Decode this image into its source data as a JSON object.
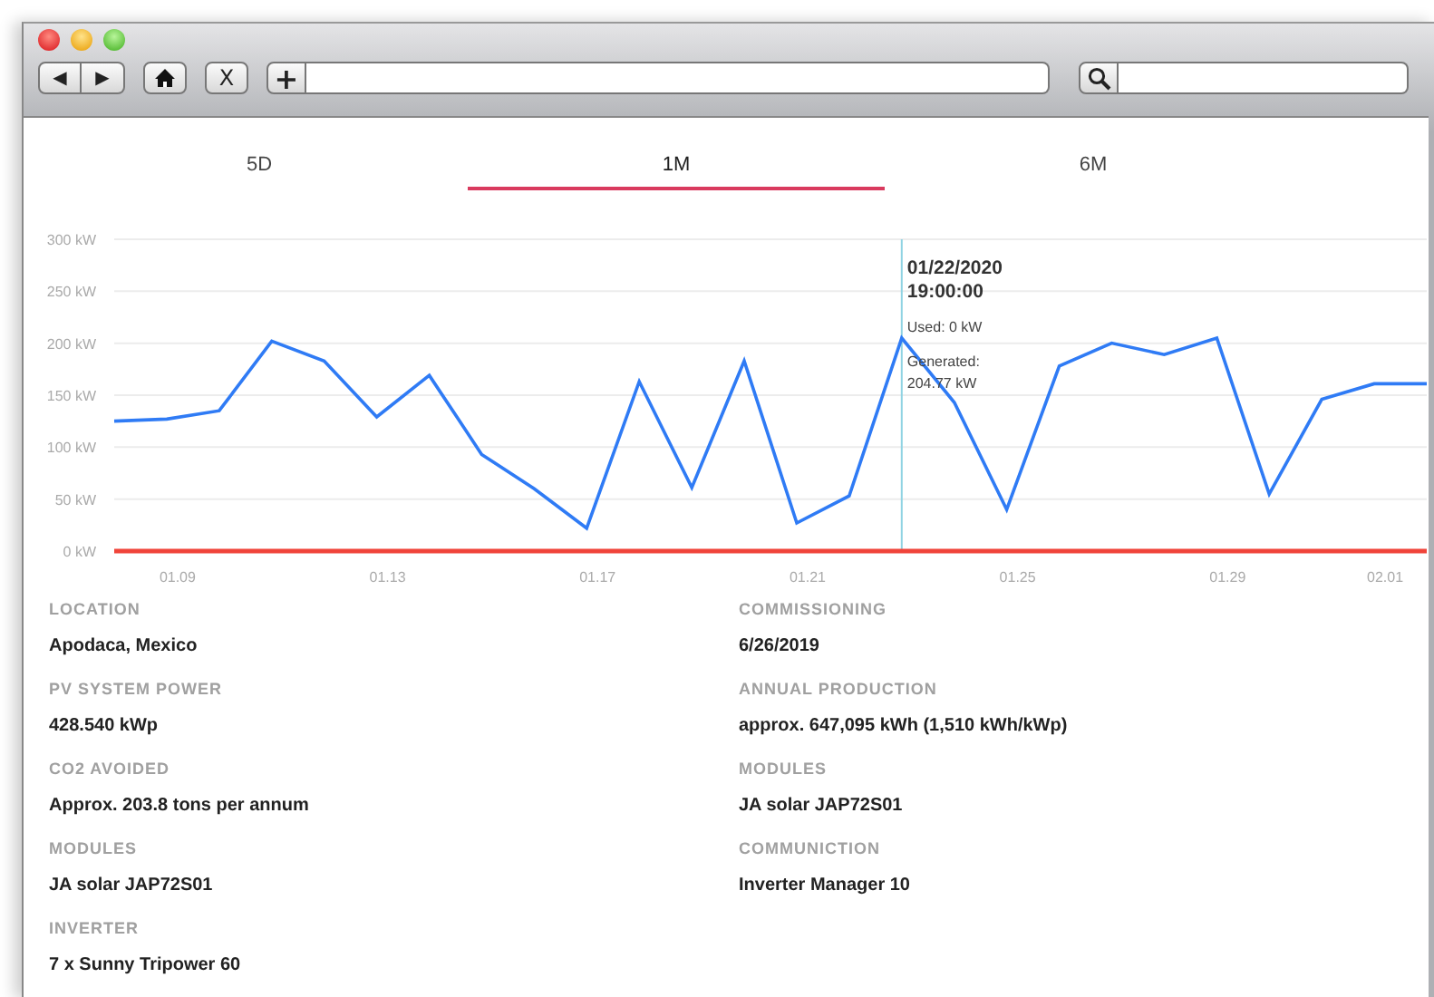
{
  "toolbar": {
    "back": "◀",
    "forward": "▶",
    "stop": "X",
    "add": "+"
  },
  "tabs": [
    {
      "label": "5D",
      "selected": false
    },
    {
      "label": "1M",
      "selected": true
    },
    {
      "label": "6M",
      "selected": false
    }
  ],
  "chart_data": {
    "type": "line",
    "grid": true,
    "categories": [
      null,
      "01.09",
      null,
      null,
      null,
      "01.13",
      null,
      null,
      null,
      "01.17",
      null,
      null,
      null,
      "01.21",
      null,
      null,
      null,
      "01.25",
      null,
      null,
      null,
      "01.29",
      null,
      null,
      "02.01",
      null
    ],
    "ylim": [
      0,
      300
    ],
    "yticks": [
      {
        "value": 0,
        "label": "0 kW"
      },
      {
        "value": 50,
        "label": "50 kW"
      },
      {
        "value": 100,
        "label": "100 kW"
      },
      {
        "value": 150,
        "label": "150 kW"
      },
      {
        "value": 200,
        "label": "200 kW"
      },
      {
        "value": 250,
        "label": "250 kW"
      },
      {
        "value": 300,
        "label": "300 kW"
      }
    ],
    "series": [
      {
        "color": "#2f7bf5",
        "values": [
          125,
          127,
          135,
          202,
          183,
          129,
          169,
          93,
          60,
          22,
          163,
          61,
          183,
          27,
          53,
          205,
          143,
          40,
          178,
          200,
          189,
          205,
          55,
          146,
          161,
          161
        ]
      },
      {
        "color": "#f0443a",
        "values": [
          0,
          0,
          0,
          0,
          0,
          0,
          0,
          0,
          0,
          0,
          0,
          0,
          0,
          0,
          0,
          0,
          0,
          0,
          0,
          0,
          0,
          0,
          0,
          0,
          0,
          0
        ]
      }
    ]
  },
  "tooltip": {
    "date": "01/22/2020",
    "time": "19:00:00",
    "lines": [
      "Used: 0 kW",
      "Generated:\n204.77 kW"
    ]
  },
  "details": [
    {
      "label": "LOCATION",
      "value": "Apodaca, Mexico"
    },
    {
      "label": "COMMISSIONING",
      "value": "6/26/2019"
    },
    {
      "label": "PV SYSTEM POWER",
      "value": "428.540 kWp"
    },
    {
      "label": "ANNUAL PRODUCTION",
      "value": "approx. 647,095 kWh (1,510 kWh/kWp)"
    },
    {
      "label": "CO2 AVOIDED",
      "value": "Approx. 203.8 tons per annum"
    },
    {
      "label": "MODULES",
      "value": "JA solar JAP72S01"
    },
    {
      "label": "MODULES",
      "value": "JA solar JAP72S01"
    },
    {
      "label": "COMMUNICTION",
      "value": "Inverter Manager 10"
    },
    {
      "label": "INVERTER",
      "value": "7 x Sunny Tripower 60"
    }
  ]
}
